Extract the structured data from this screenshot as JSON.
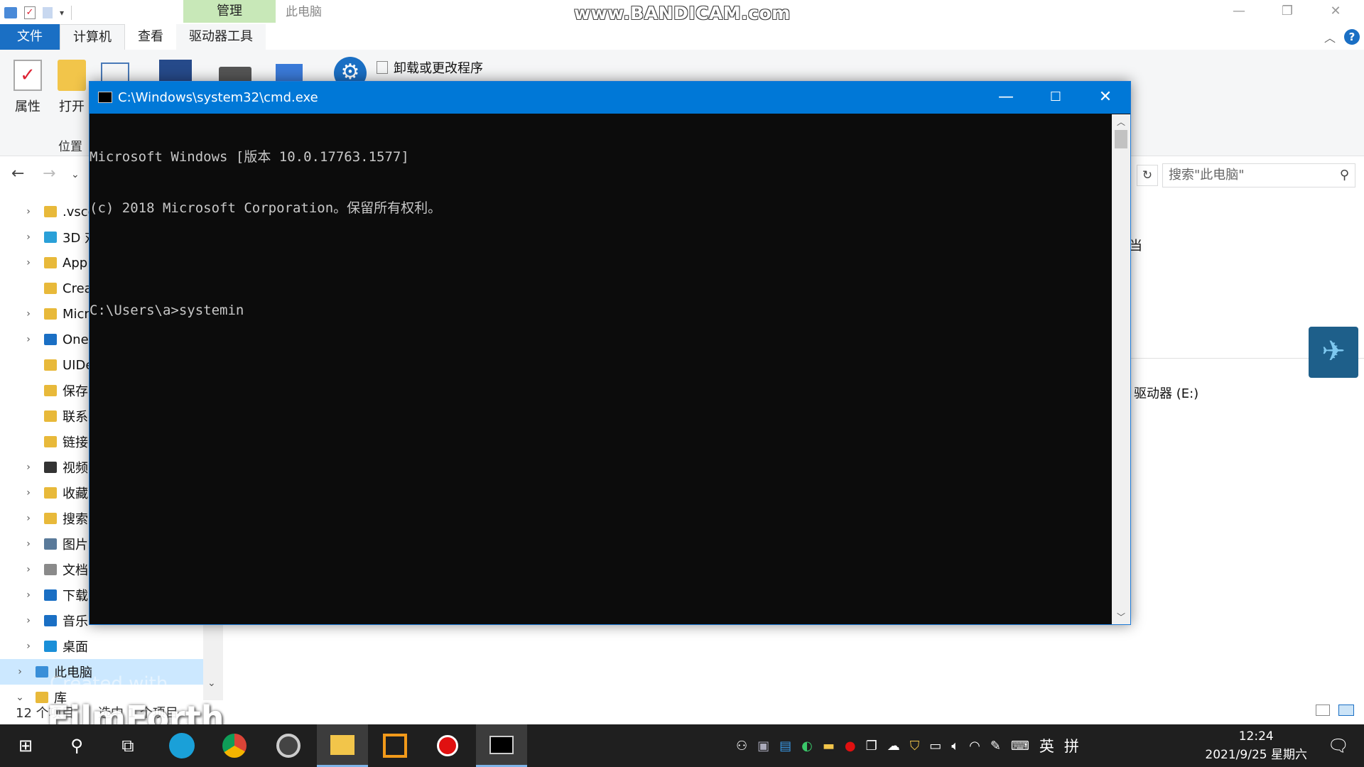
{
  "explorer": {
    "window_title": "此电脑",
    "context_tab": "管理",
    "tabs": [
      "文件",
      "计算机",
      "查看",
      "驱动器工具"
    ],
    "ribbon": {
      "properties_label": "属性",
      "open_label": "打开",
      "uninstall_label": "卸载或更改程序",
      "group_label": "位置"
    },
    "search_placeholder": "搜索\"此电脑\"",
    "tree": [
      {
        "label": ".vsco",
        "expandable": true,
        "color": "#e8b93a"
      },
      {
        "label": "3D 对",
        "expandable": true,
        "color": "#2aa0d8"
      },
      {
        "label": "App",
        "expandable": true,
        "color": "#e8b93a"
      },
      {
        "label": "Crea",
        "expandable": false,
        "color": "#e8b93a"
      },
      {
        "label": "Micr",
        "expandable": true,
        "color": "#e8b93a"
      },
      {
        "label": "One",
        "expandable": true,
        "color": "#1a6fc4"
      },
      {
        "label": "UIDe",
        "expandable": false,
        "color": "#e8b93a"
      },
      {
        "label": "保存",
        "expandable": false,
        "color": "#e8b93a"
      },
      {
        "label": "联系",
        "expandable": false,
        "color": "#e8b93a"
      },
      {
        "label": "链接",
        "expandable": false,
        "color": "#e8b93a"
      },
      {
        "label": "视频",
        "expandable": true,
        "color": "#333"
      },
      {
        "label": "收藏",
        "expandable": true,
        "color": "#e8b93a"
      },
      {
        "label": "搜索",
        "expandable": true,
        "color": "#e8b93a"
      },
      {
        "label": "图片",
        "expandable": true,
        "color": "#5a7a9a"
      },
      {
        "label": "文档",
        "expandable": true,
        "color": "#8a8a8a"
      },
      {
        "label": "下载",
        "expandable": true,
        "color": "#1a6fc4"
      },
      {
        "label": "音乐",
        "expandable": true,
        "color": "#1a6fc4"
      },
      {
        "label": "桌面",
        "expandable": true,
        "color": "#1a8fd8"
      },
      {
        "label": "此电脑",
        "expandable": true,
        "color": "#3a8fd8",
        "selected": true
      },
      {
        "label": "库",
        "expandable": true,
        "expanded": true,
        "color": "#e8b93a"
      }
    ],
    "right_pane": {
      "partial_text": "当",
      "drive_label": "驱动器 (E:)"
    },
    "status": {
      "items_count": "12 个项目",
      "selection": "选中 1 个项目"
    }
  },
  "cmd": {
    "title": "C:\\Windows\\system32\\cmd.exe",
    "lines": [
      "Microsoft Windows [版本 10.0.17763.1577]",
      "(c) 2018 Microsoft Corporation。保留所有权利。",
      "",
      "C:\\Users\\a>systemin"
    ]
  },
  "watermarks": {
    "bandicam": "www.BANDICAM.com",
    "filmforth_small": "Created with",
    "filmforth": "FilmForth"
  },
  "taskbar": {
    "apps": [
      "start",
      "search",
      "task-view",
      "edge",
      "chrome",
      "media-player",
      "file-explorer",
      "vm-app",
      "record",
      "cmd"
    ],
    "ime_lang": "英",
    "ime_mode": "拼",
    "time": "12:24",
    "date": "2021/9/25 星期六"
  }
}
